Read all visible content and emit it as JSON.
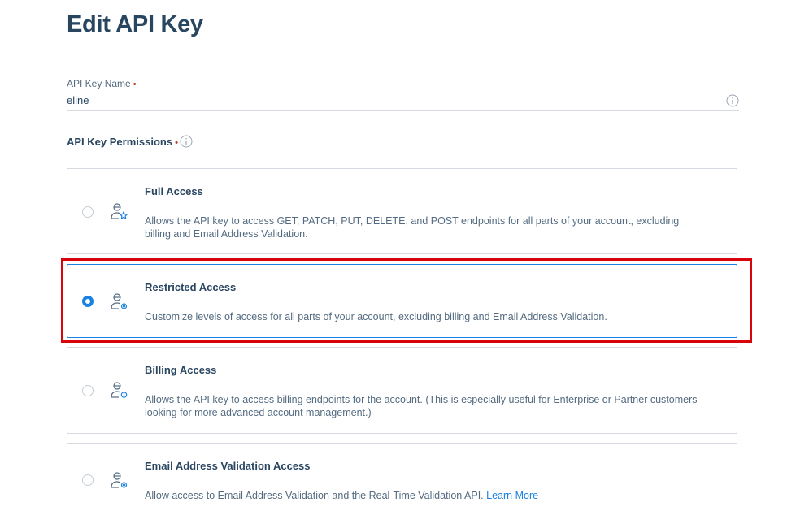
{
  "page": {
    "title": "Edit API Key"
  },
  "name_field": {
    "label": "API Key Name",
    "required_mark": "•",
    "value": "eline"
  },
  "permissions": {
    "label": "API Key Permissions",
    "required_mark": "•",
    "options": [
      {
        "title": "Full Access",
        "description": "Allows the API key to access GET, PATCH, PUT, DELETE, and POST endpoints for all parts of your account, excluding billing and Email Address Validation.",
        "selected": false,
        "icon": "user-star-icon"
      },
      {
        "title": "Restricted Access",
        "description": "Customize levels of access for all parts of your account, excluding billing and Email Address Validation.",
        "selected": true,
        "icon": "user-gear-icon"
      },
      {
        "title": "Billing Access",
        "description": "Allows the API key to access billing endpoints for the account. (This is especially useful for Enterprise or Partner customers looking for more advanced account management.)",
        "selected": false,
        "icon": "user-dollar-icon"
      },
      {
        "title": "Email Address Validation Access",
        "description": "Allow access to Email Address Validation and the Real-Time Validation API.",
        "link": "Learn More",
        "selected": false,
        "icon": "user-gear-icon"
      }
    ]
  },
  "colors": {
    "accent": "#1a82e2",
    "highlight": "#d9040b",
    "text": "#294661",
    "muted": "#546b81"
  }
}
